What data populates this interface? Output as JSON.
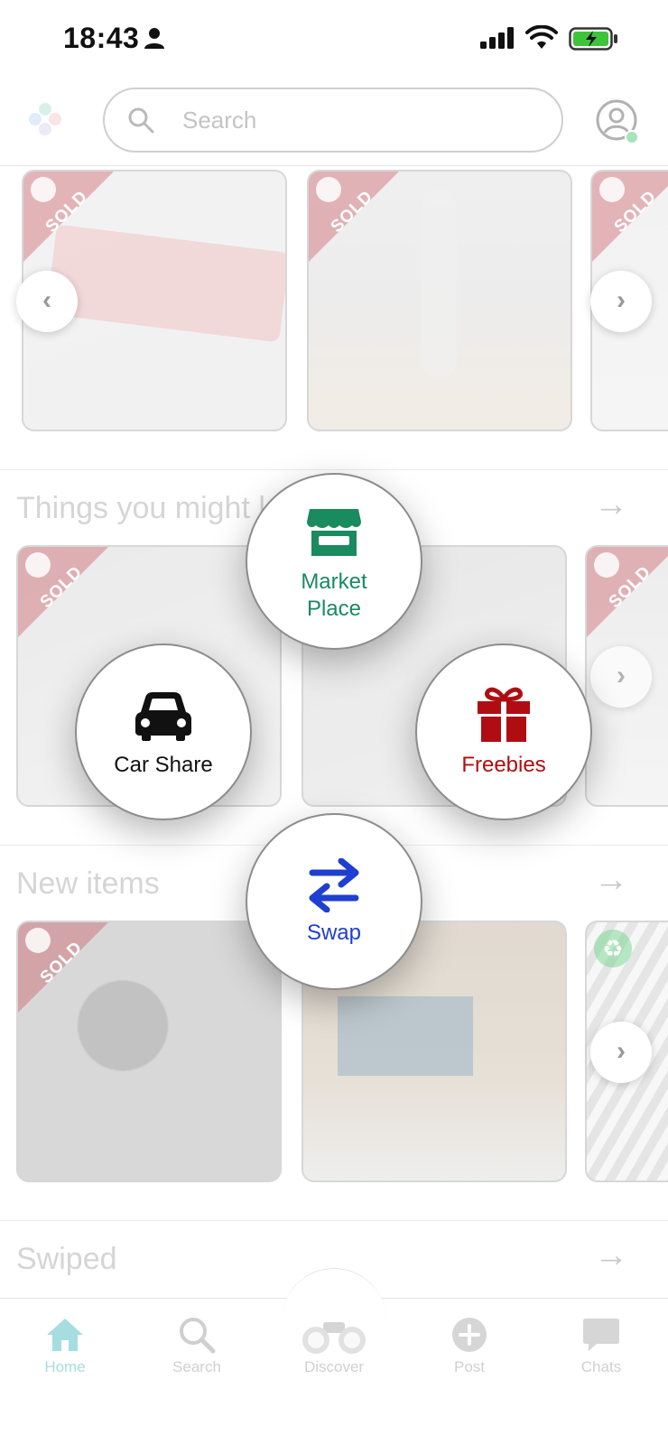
{
  "status_bar": {
    "time": "18:43"
  },
  "header": {
    "search_placeholder": "Search"
  },
  "sections": {
    "things_title": "Things you might l",
    "new_items_title": "New items",
    "swiped_title": "Swiped"
  },
  "badges": {
    "sold": "SOLD"
  },
  "overlay": {
    "market": {
      "line1": "Market",
      "line2": "Place",
      "color": "#1a8a5f"
    },
    "car_share": {
      "label": "Car Share",
      "color": "#111111"
    },
    "freebies": {
      "label": "Freebies",
      "color": "#b00d12"
    },
    "swap": {
      "label": "Swap",
      "color": "#1f3fd0"
    }
  },
  "tabbar": {
    "home": "Home",
    "search": "Search",
    "discover": "Discover",
    "post": "Post",
    "chats": "Chats"
  },
  "colors": {
    "accent": "#a6dde0",
    "sold": "#c8505a"
  },
  "icons": [
    "person-icon",
    "signal-icon",
    "wifi-icon",
    "battery-icon",
    "search-icon",
    "avatar-icon",
    "store-icon",
    "car-icon",
    "gift-icon",
    "swap-arrows-icon",
    "home-icon",
    "binoculars-icon",
    "plus-icon",
    "chat-icon"
  ]
}
